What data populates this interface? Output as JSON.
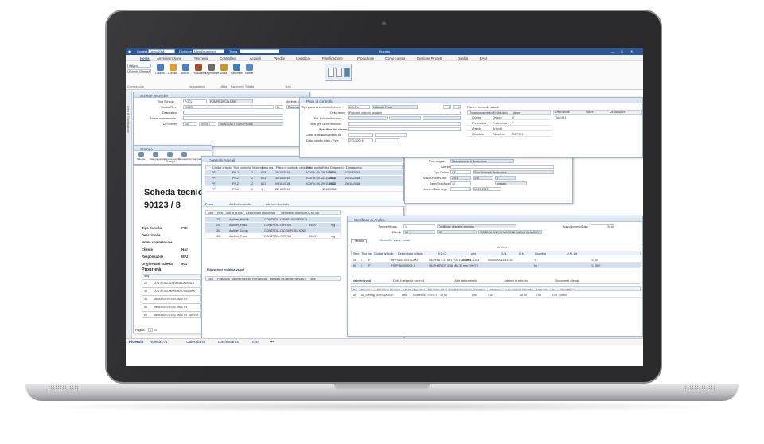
{
  "app": {
    "title": "Fluentis",
    "company_label": "Società",
    "company_value": "Demo 2008",
    "division_label": "Divisione",
    "division_value": "Main Department",
    "find_label": "Trova"
  },
  "menu": [
    "Home",
    "Amministrazione",
    "Tesoreria",
    "Controlling",
    "Acquisti",
    "Vendite",
    "Logistica",
    "Pianificazione",
    "Produzione",
    "Conto Lavoro",
    "Gestione Progetti",
    "Qualità",
    "EAM"
  ],
  "ribbon": {
    "combo_language": "Italiano",
    "combo_enterprise": "Fluentis Enterprise",
    "buttons": [
      "Contatti",
      "Contatti",
      "Articoli",
      "Produzione",
      "Dipendente",
      "Utilità",
      "Parametri",
      "Tabelle"
    ],
    "groups": [
      "Connessione",
      "Anagrafiche",
      "Utilità",
      "Parametri",
      "Tabelle",
      "Temi"
    ]
  },
  "sidebar_label": "Area di Navigazione",
  "schede_tecniche": {
    "title": "Schede Tecniche",
    "tipo_scheda_label": "Tipo Scheda",
    "tipo_scheda_code": "POCL",
    "tipo_scheda_desc": "POMPE DI CALORE",
    "codice_label": "Codice/Rev.",
    "codice_value": "90123",
    "codice_rev": "8",
    "descrizione_label": "Descrizione",
    "nome_commerciale_label": "Nome commerciale",
    "del_cliente_label": "Del cliente",
    "del_cliente_code": "101",
    "del_cliente_num": "000014",
    "del_cliente_name": "HARDCAST EUROPE 456",
    "attributi_label": "Attributi scheda",
    "raggruppamento_label": "Raggruppamento"
  },
  "stampa": {
    "title": "Stampa",
    "buttons": [
      "Stampa",
      "Stampa veloce",
      "Imposta pagina",
      "Impostazioni stampante"
    ],
    "group": "Stampa"
  },
  "report": {
    "heading": "Scheda tecnica",
    "number": "90123 / 8",
    "fields": [
      {
        "label": "Tipo Scheda",
        "value": "POI"
      },
      {
        "label": "Descrizione",
        "value": ""
      },
      {
        "label": "Nome commerciale",
        "value": ""
      },
      {
        "label": "Cliente",
        "value": "HAI"
      },
      {
        "label": "Responsabile",
        "value": "MAI"
      },
      {
        "label": "Origine dati scheda",
        "value": "901"
      }
    ],
    "properties_heading": "Proprietà",
    "properties_col": "Seq.",
    "properties": [
      {
        "seq": "20",
        "desc": "CONTROLLO CORRISPONDENZA"
      },
      {
        "seq": "30",
        "desc": "CONTROLLO APPARECCHIATURA"
      },
      {
        "seq": "40",
        "desc": "ABRASION RESISTANCE BY"
      },
      {
        "seq": "50",
        "desc": "ABRASION RESISTANCE BY"
      },
      {
        "seq": "60",
        "desc": "ABRASION RESISTANCE BY TABER 5"
      }
    ],
    "method_text": "FR 0344 method/(3.56, 250 g, 35 cycles)",
    "method_value": "Valore",
    "pager_label": "Pagina",
    "pager_value": "1",
    "pager_total": "/1"
  },
  "controllo_articoli": {
    "title": "Controllo Articoli",
    "columns": [
      "Codice articolo",
      "Tipo controllo",
      "Numero",
      "Data reg.",
      "Piano di controllo utilizzato",
      "Data analisi",
      "Esito",
      "Data esito",
      "Data approv."
    ],
    "rows": [
      [
        "PF",
        "PF-2",
        "2",
        "625",
        "26/10/2018",
        "BCoFlo-99-2",
        "29/10/2018",
        "NC1",
        "02/09/2019"
      ],
      [
        "PF",
        "PF-2",
        "2",
        "633",
        "30/10/2018",
        "BCoFlo-99-2",
        "02/11/2018",
        "NC1",
        "20/11/2018"
      ],
      [
        "PF",
        "PF-2",
        "2",
        "641",
        "09/11/2018",
        "BCoFlo-99-2",
        "09/11/2018",
        "NC2",
        "28/11/2018"
      ],
      [
        "PF",
        "PF-2",
        "2",
        "1",
        "22/10/2018",
        "",
        "22/10/2018",
        "",
        ""
      ]
    ],
    "tab_prove": "Prove",
    "tab_attributi_controllo": "Attributi controllo",
    "tab_attributi_articolo": "Attributi di articolo",
    "prove_columns": [
      "Seq.",
      "Reg.",
      "Tipo di Prova",
      "Descrizione tipo prova",
      "Strumento di misura",
      "U.M. Val."
    ],
    "prove_rows": [
      [
        "10",
        "ArcMet_Fiorillo",
        "CONTROLLO FORMA SFERICA",
        "",
        ""
      ],
      [
        "20",
        "ArcMet_Peso",
        "CONTROLLO PESO",
        "BIL07",
        "mg"
      ],
      [
        "30",
        "ArcMet_Comp",
        "CONTROLLO COMPOSIZIONE",
        "",
        ""
      ],
      [
        "40",
        "ArcMet_Peso",
        "CONTROLLO PESO",
        "BIL07",
        "mg"
      ]
    ],
    "rilevazione_label": "Rilevazione multipla valori",
    "rilevazione_columns": [
      "Seq.",
      "Posizione",
      "Valore Rilevato",
      "Rilevato da",
      "Rilevato da utente",
      "Rilevato il",
      "Note"
    ],
    "origine_label": "Doc. origine",
    "origine_value": "Segnalazione di Produzione",
    "cliente_label": "Cliente",
    "tipo_ordine_label": "Tipo Ordine",
    "tipo_ordine_code": "OF",
    "tipo_ordine_value": "Tipo Ordine di Produzione",
    "anno_label": "Anno/Ordine/Lotto",
    "anno_value": "2018",
    "ordine_value": "135",
    "lotto_value": "4",
    "fase_label": "Fase/Sottofase",
    "fase_value": "10",
    "fase_desc": "Impasto",
    "numero_label": "Numero/Data segn.",
    "numero_value": "1",
    "numero_date": "06/09/2019"
  },
  "piani": {
    "title": "Piani di controllo",
    "tipo_label": "Tipo piano di controllo/Numero",
    "tipo_value": "BCoFlo",
    "tipo_desc": "Collaudo Finale",
    "num_value": "2",
    "rev_value": "1",
    "desc_label": "Descrizione",
    "desc_value": "Piano di controllo appalme",
    "per_cliente_label": "Per il cliente/fornitore",
    "nota_label": "Nota per cliente/fornitore",
    "specifica_label": "Specifica del cliente",
    "data_richiesta_label": "Data richiesta/Richiesto da",
    "data_validita_label": "Data Validità Inizio / Fine",
    "data_validita_value": "27/10/2018",
    "tab_titolo": "Piano di controllo articoli",
    "tab_columns": [
      "Raggruppamento",
      "Entità dato",
      "Valore"
    ],
    "tab_rows": [
      [
        "Origine",
        "Origine",
        "IT"
      ],
      [
        "Preferenza",
        "Preferenza",
        "Y"
      ],
      [
        "Articolo",
        "Articolo",
        ""
      ],
      [
        "Obsoleto",
        "Obsoleto",
        "MARTIN"
      ]
    ],
    "right_col_desc": "Descrizione",
    "right_col_valore": "Valore",
    "right_col_da": "Da stampare",
    "right_val": "ITALIAN"
  },
  "certificati": {
    "title": "Certificati di Analisi",
    "tipo_label": "Tipo certificato",
    "tipo_value": "1",
    "tipo_desc": "Certificato di analisi standard",
    "anno_label": "Anno/Numero/Data",
    "anno_value": "2019",
    "cliente_label": "Cliente",
    "cliente_code": "03",
    "cliente_value": "02",
    "cliente_name": "MONDINI SNC DI MONDINI CARLO CLAUDIO",
    "tab_testata": "Testata",
    "tab_controlli": "Controlli e valori rilevati",
    "articolo_label": "Articolo",
    "columns": [
      "Seq.",
      "Tipo riga",
      "Codice articolo",
      "Descrizione articolo",
      "U.D.C.",
      "Lotto",
      "S.N.",
      "U.M.",
      "Quantità",
      "U.M. Alt."
    ],
    "rows": [
      [
        "10",
        "1",
        "P",
        "MPF0033-02571200",
        "SILPHIA 3.37 M/1\"100 1280 mm",
        "2018-1-2-0-4",
        "00000000111111111",
        "Y",
        "",
        "13,00"
      ],
      [
        "40",
        "1",
        "P",
        "PSPF56009W09-1",
        "SILPHER CF 3/38 MM 35 mm WHITE",
        "",
        "",
        "kg",
        "",
        "13,000"
      ]
    ],
    "sub_tabs": [
      "Valori rilevati",
      "Dati di dettaglio controlli",
      "Altri dati controllo",
      "Attributi di articolo",
      "Documenti allegati"
    ],
    "val_columns": [
      "Seq.",
      "Tipo prova",
      "Descrizione tipo prova",
      "U.M. Val.",
      "Tipo valore",
      "Tipo limite",
      "Valore nominale",
      "Limite inferiore",
      "L.Min(tollr-)",
      "L.Min(toll+)",
      "Limite massimo",
      "L.Max(tollr-)",
      "L.Max(toll+)",
      "%",
      "Valore Rilevato"
    ],
    "val_rows": [
      [
        "10",
        "Sil_Shrnkg",
        "SHRINKAGE",
        "mm",
        "Numerico",
        "<=x<=+",
        "10,00",
        "",
        "0,00",
        "0,00",
        "",
        "10,00",
        "0,00",
        "0,00",
        "10,00"
      ]
    ]
  },
  "status_bar": {
    "brand": "Fluentis",
    "items": [
      "Attività 7/1",
      "Calendario",
      "Dashboards",
      "Trova",
      "•••"
    ]
  }
}
